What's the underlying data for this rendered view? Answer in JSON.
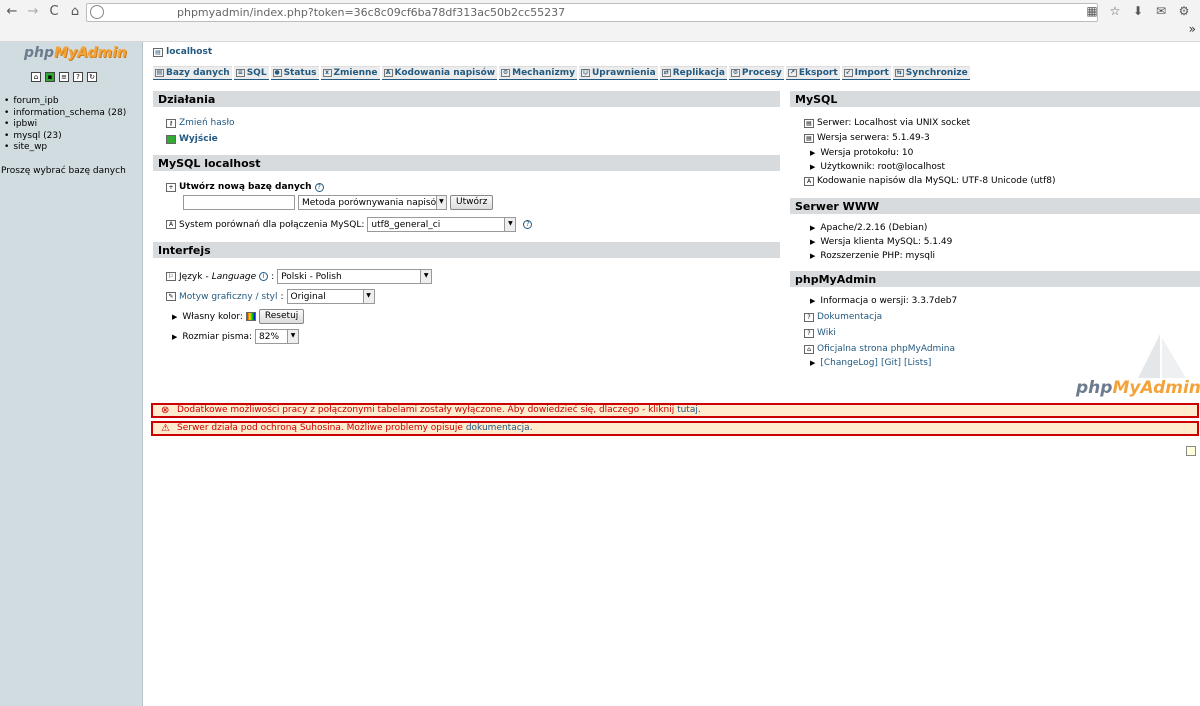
{
  "browser": {
    "url": "phpmyadmin/index.php?token=36c8c09cf6ba78df313ac50b2cc55237"
  },
  "sidebar": {
    "logo_left": "php",
    "logo_right": "MyAdmin",
    "databases": [
      "forum_ipb",
      "information_schema (28)",
      "ipbwi",
      "mysql (23)",
      "site_wp"
    ],
    "choose_text": "Proszę wybrać bazę danych"
  },
  "main": {
    "server_link": "localhost",
    "tabs": [
      "Bazy danych",
      "SQL",
      "Status",
      "Zmienne",
      "Kodowania napisów",
      "Mechanizmy",
      "Uprawnienia",
      "Replikacja",
      "Procesy",
      "Eksport",
      "Import",
      "Synchronize"
    ]
  },
  "actions": {
    "header": "Działania",
    "change_password": "Zmień hasło",
    "logout": "Wyjście"
  },
  "mysql_local": {
    "header": "MySQL localhost",
    "create_db_label": "Utwórz nową bazę danych",
    "create_db_value": "",
    "collation_select": "Metoda porównywania napisów",
    "create_button": "Utwórz",
    "connection_collation_label": "System porównań dla połączenia MySQL:",
    "connection_collation_value": "utf8_general_ci"
  },
  "interface": {
    "header": "Interfejs",
    "language_label": "Język",
    "language_label_en": "Language",
    "language_value": "Polski - Polish",
    "theme_label": "Motyw graficzny / styl",
    "theme_value": "Original",
    "custom_color_label": "Własny kolor:",
    "reset_button": "Resetuj",
    "font_size_label": "Rozmiar pisma:",
    "font_size_value": "82%"
  },
  "mysql_info": {
    "header": "MySQL",
    "server": "Serwer: Localhost via UNIX socket",
    "version": "Wersja serwera: 5.1.49-3",
    "protocol": "Wersja protokołu: 10",
    "user": "Użytkownik: root@localhost",
    "charset": "Kodowanie napisów dla MySQL: UTF-8 Unicode (utf8)"
  },
  "www": {
    "header": "Serwer WWW",
    "apache": "Apache/2.2.16 (Debian)",
    "client": "Wersja klienta MySQL: 5.1.49",
    "ext": "Rozszerzenie PHP: mysqli"
  },
  "pma": {
    "header": "phpMyAdmin",
    "version": "Informacja o wersji: 3.3.7deb7",
    "docs": "Dokumentacja",
    "wiki": "Wiki",
    "official": "Oficjalna strona phpMyAdmina",
    "changelog": "[ChangeLog]",
    "git": "[Git]",
    "lists": "[Lists]"
  },
  "messages": {
    "error_text": "Dodatkowe możliwości pracy z połączonymi tabelami zostały wyłączone. Aby dowiedzieć się, dlaczego - kliknij",
    "error_link": "tutaj",
    "warning_text": "Serwer działa pod ochroną Suhosina. Możliwe problemy opisuje",
    "warning_link": "dokumentacja"
  }
}
